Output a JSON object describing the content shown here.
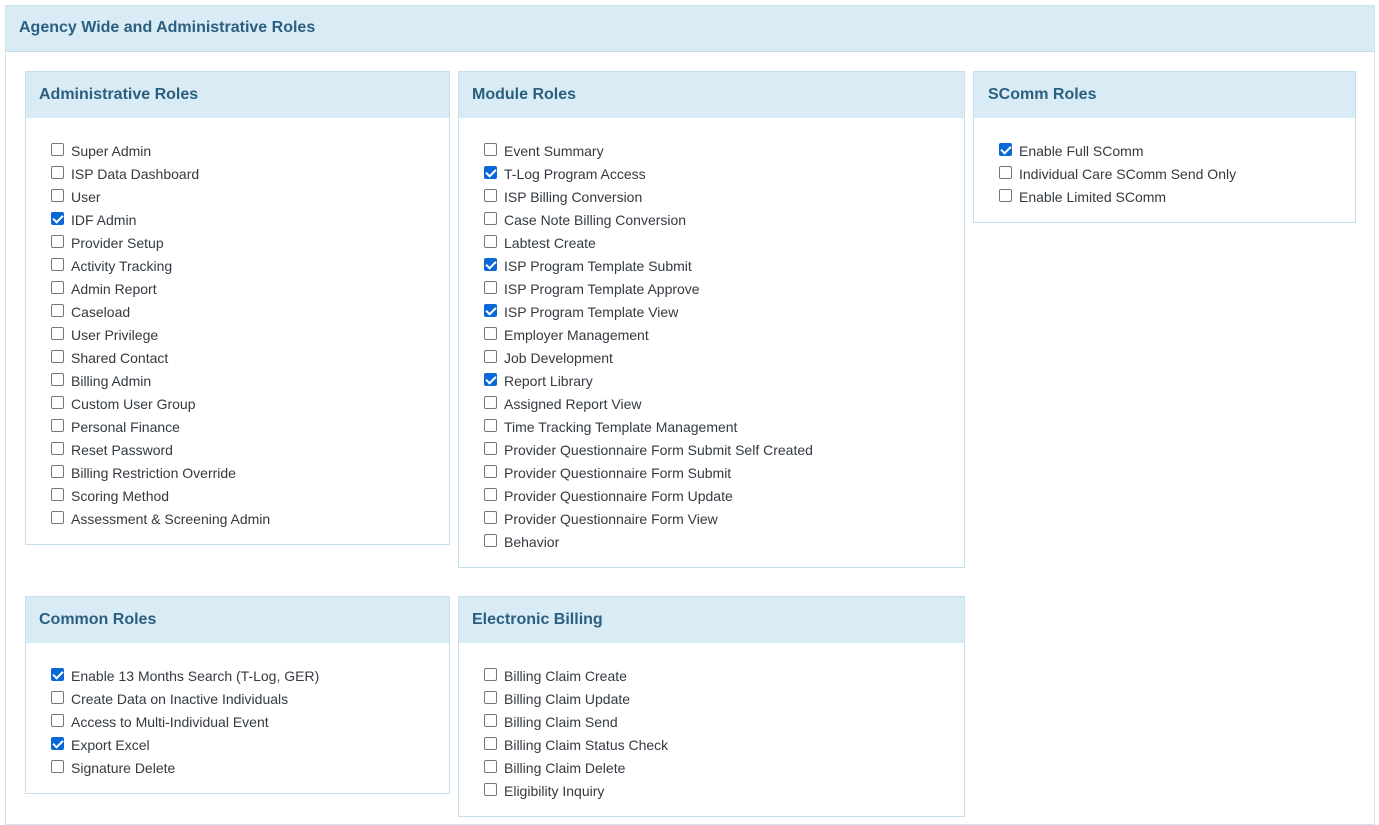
{
  "page_title": "Agency Wide and Administrative Roles",
  "panels": {
    "administrative": {
      "title": "Administrative Roles",
      "items": [
        {
          "label": "Super Admin",
          "checked": false
        },
        {
          "label": "ISP Data Dashboard",
          "checked": false
        },
        {
          "label": "User",
          "checked": false
        },
        {
          "label": "IDF Admin",
          "checked": true
        },
        {
          "label": "Provider Setup",
          "checked": false
        },
        {
          "label": "Activity Tracking",
          "checked": false
        },
        {
          "label": "Admin Report",
          "checked": false
        },
        {
          "label": "Caseload",
          "checked": false
        },
        {
          "label": "User Privilege",
          "checked": false
        },
        {
          "label": "Shared Contact",
          "checked": false
        },
        {
          "label": "Billing Admin",
          "checked": false
        },
        {
          "label": "Custom User Group",
          "checked": false
        },
        {
          "label": "Personal Finance",
          "checked": false
        },
        {
          "label": "Reset Password",
          "checked": false
        },
        {
          "label": "Billing Restriction Override",
          "checked": false
        },
        {
          "label": "Scoring Method",
          "checked": false
        },
        {
          "label": "Assessment & Screening Admin",
          "checked": false
        }
      ]
    },
    "module": {
      "title": "Module Roles",
      "items": [
        {
          "label": "Event Summary",
          "checked": false
        },
        {
          "label": "T-Log Program Access",
          "checked": true
        },
        {
          "label": "ISP Billing Conversion",
          "checked": false
        },
        {
          "label": "Case Note Billing Conversion",
          "checked": false
        },
        {
          "label": "Labtest Create",
          "checked": false
        },
        {
          "label": "ISP Program Template Submit",
          "checked": true
        },
        {
          "label": "ISP Program Template Approve",
          "checked": false
        },
        {
          "label": "ISP Program Template View",
          "checked": true
        },
        {
          "label": "Employer Management",
          "checked": false
        },
        {
          "label": "Job Development",
          "checked": false
        },
        {
          "label": "Report Library",
          "checked": true
        },
        {
          "label": "Assigned Report View",
          "checked": false
        },
        {
          "label": "Time Tracking Template Management",
          "checked": false
        },
        {
          "label": "Provider Questionnaire Form Submit Self Created",
          "checked": false
        },
        {
          "label": "Provider Questionnaire Form Submit",
          "checked": false
        },
        {
          "label": "Provider Questionnaire Form Update",
          "checked": false
        },
        {
          "label": "Provider Questionnaire Form View",
          "checked": false
        },
        {
          "label": "Behavior",
          "checked": false
        }
      ]
    },
    "scomm": {
      "title": "SComm Roles",
      "items": [
        {
          "label": "Enable Full SComm",
          "checked": true
        },
        {
          "label": "Individual Care SComm Send Only",
          "checked": false
        },
        {
          "label": "Enable Limited SComm",
          "checked": false
        }
      ]
    },
    "common": {
      "title": "Common Roles",
      "items": [
        {
          "label": "Enable 13 Months Search (T-Log, GER)",
          "checked": true
        },
        {
          "label": "Create Data on Inactive Individuals",
          "checked": false
        },
        {
          "label": "Access to Multi-Individual Event",
          "checked": false
        },
        {
          "label": "Export Excel",
          "checked": true
        },
        {
          "label": "Signature Delete",
          "checked": false
        }
      ]
    },
    "ebilling": {
      "title": "Electronic Billing",
      "items": [
        {
          "label": "Billing Claim Create",
          "checked": false
        },
        {
          "label": "Billing Claim Update",
          "checked": false
        },
        {
          "label": "Billing Claim Send",
          "checked": false
        },
        {
          "label": "Billing Claim Status Check",
          "checked": false
        },
        {
          "label": "Billing Claim Delete",
          "checked": false
        },
        {
          "label": "Eligibility Inquiry",
          "checked": false
        }
      ]
    }
  },
  "colors": {
    "header_bg": "#d9ecf5",
    "header_text": "#2b5f80",
    "checkbox_checked": "#0a68d6"
  }
}
